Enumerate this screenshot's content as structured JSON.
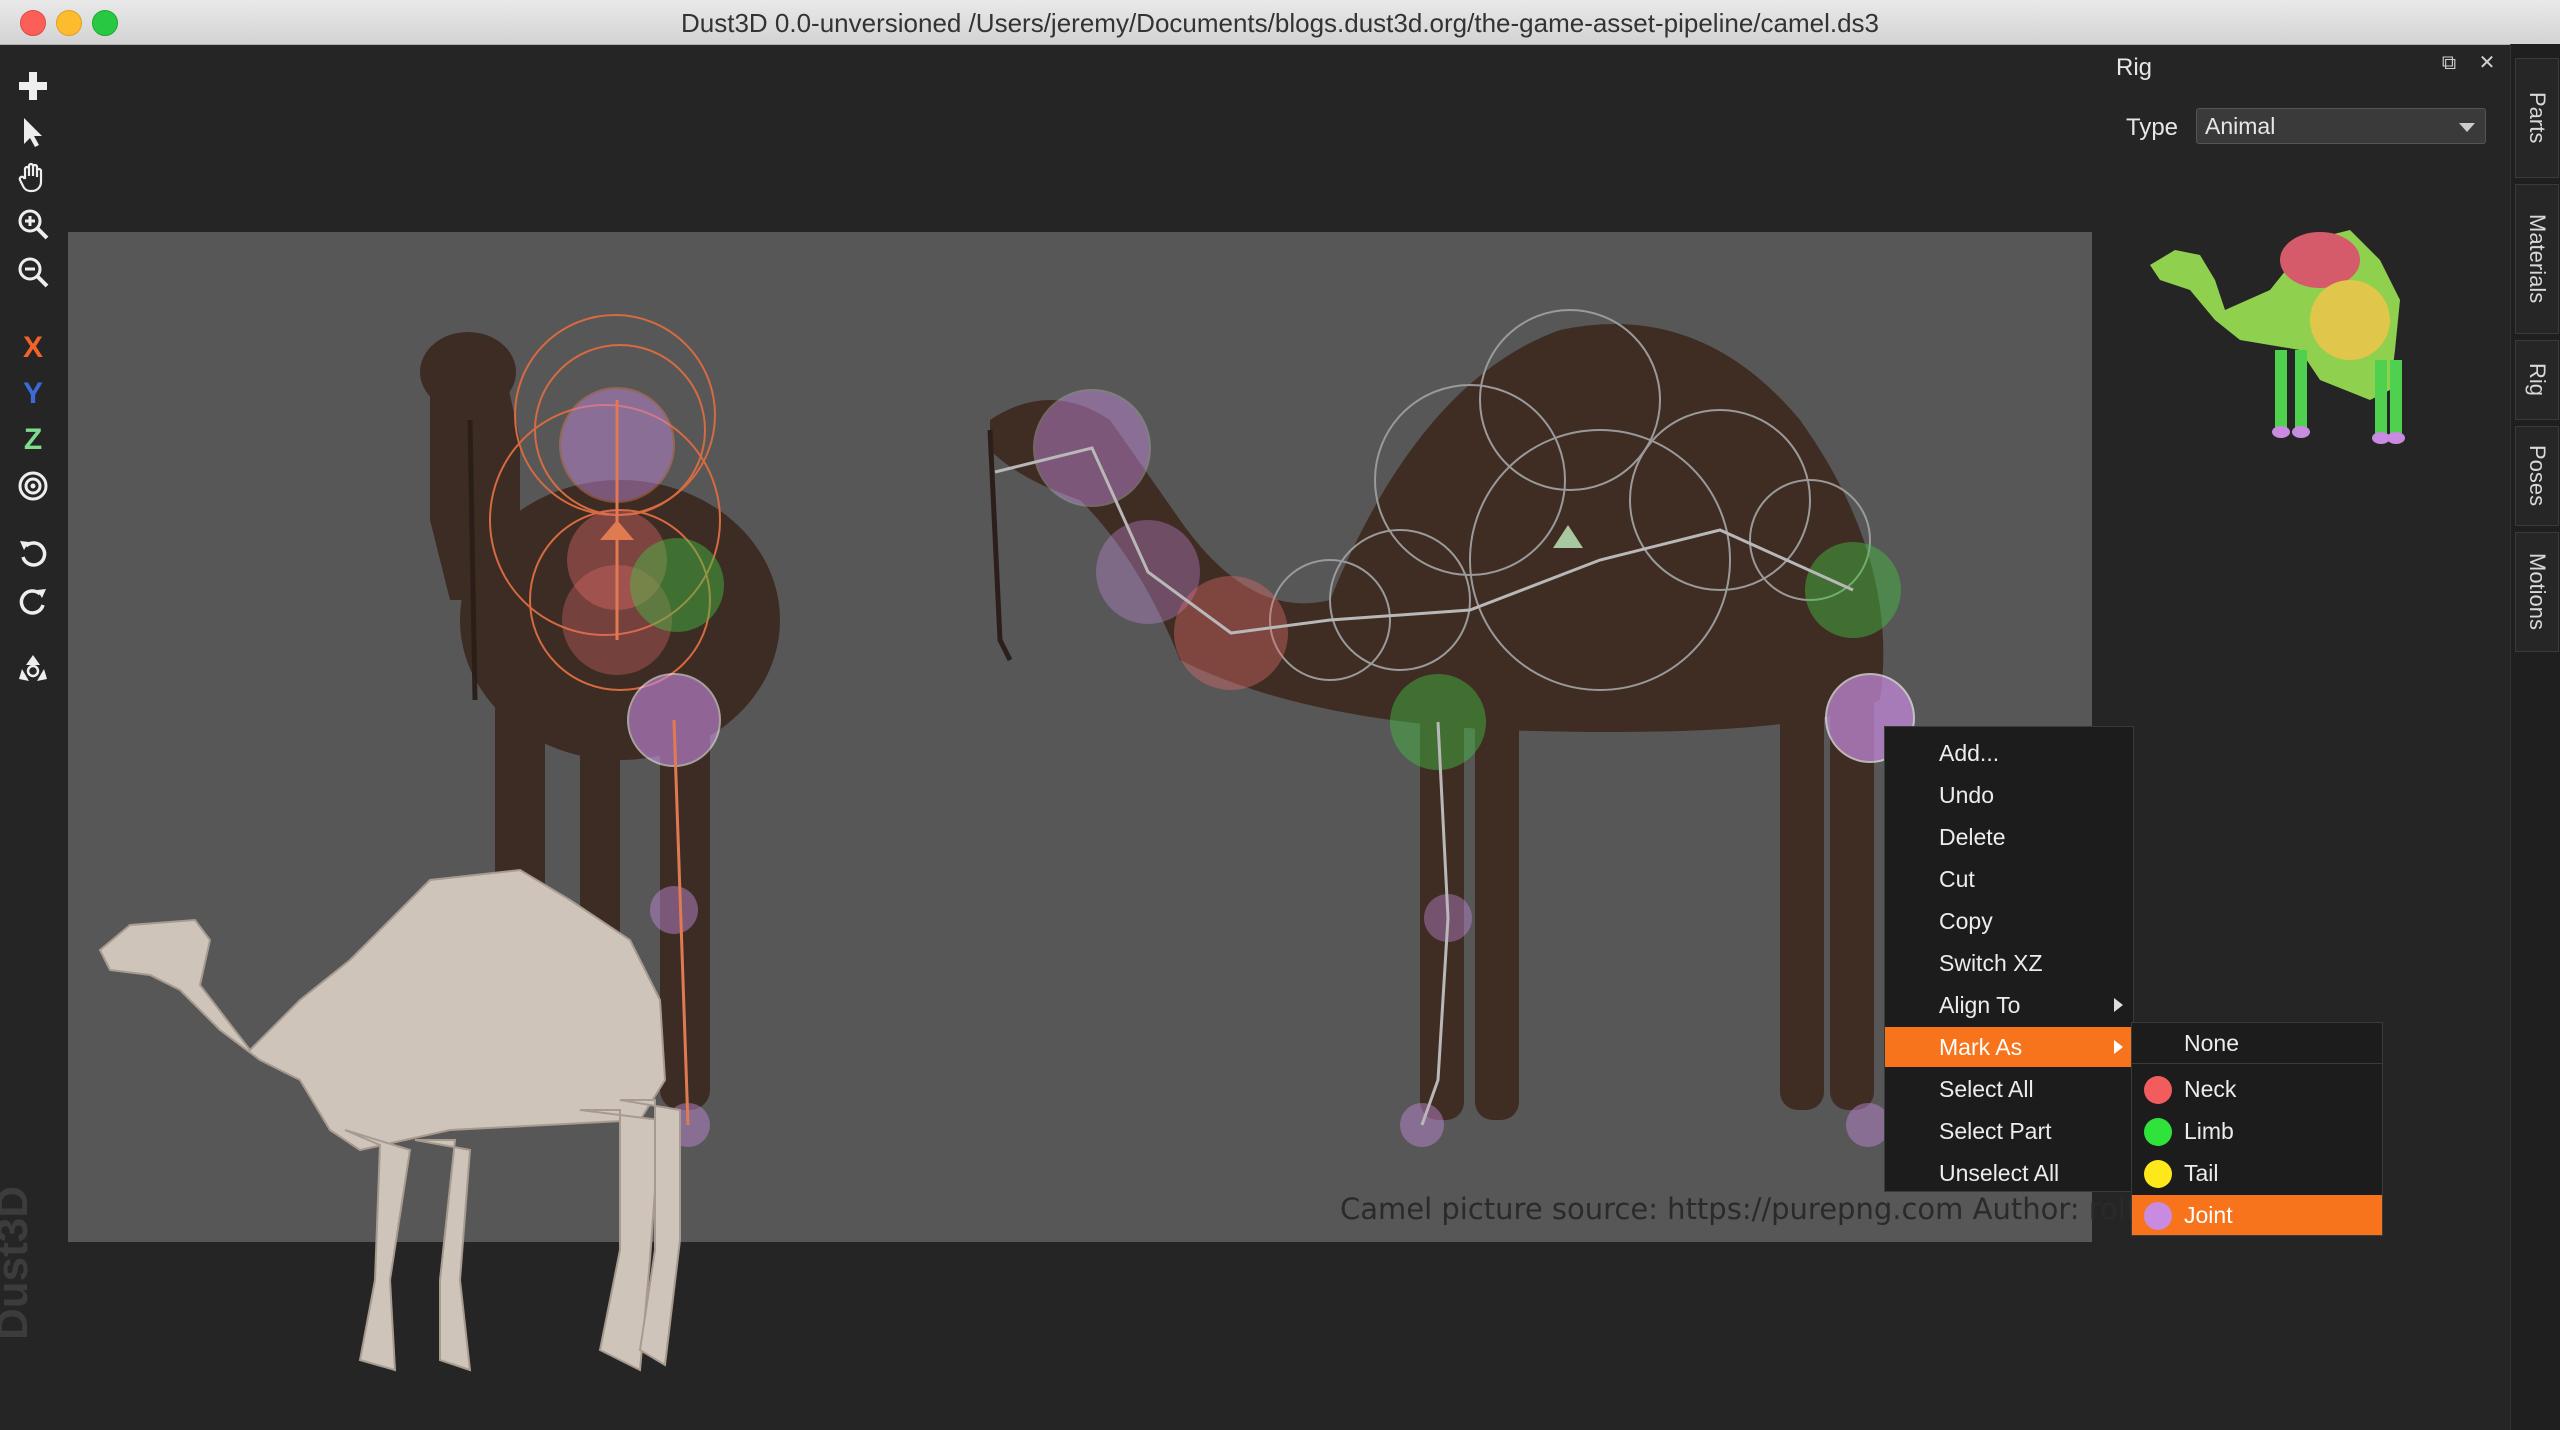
{
  "window": {
    "title": "Dust3D 0.0-unversioned /Users/jeremy/Documents/blogs.dust3d.org/the-game-asset-pipeline/camel.ds3"
  },
  "toolbar": {
    "x_label": "X",
    "y_label": "Y",
    "z_label": "Z"
  },
  "canvas": {
    "credit": "Camel picture source: https://purepng.com Author: rolf_nalder",
    "watermark": "Dust3D"
  },
  "rig_panel": {
    "title": "Rig",
    "type_label": "Type",
    "type_value": "Animal"
  },
  "tabs": [
    "Parts",
    "Materials",
    "Rig",
    "Poses",
    "Motions"
  ],
  "context_menu": {
    "items": [
      "Add...",
      "Undo",
      "Delete",
      "Cut",
      "Copy",
      "Switch XZ",
      "Align To",
      "Mark As",
      "Select All",
      "Select Part",
      "Unselect All"
    ],
    "active": "Mark As"
  },
  "mark_as_submenu": {
    "items": [
      {
        "label": "None",
        "color": ""
      },
      {
        "label": "Neck",
        "color": "#f25c5c"
      },
      {
        "label": "Limb",
        "color": "#2fe33a"
      },
      {
        "label": "Tail",
        "color": "#ffe81a"
      },
      {
        "label": "Joint",
        "color": "#c88be0"
      }
    ],
    "active": "Joint"
  },
  "colors": {
    "accent": "#f7741c",
    "neck": "#f25c5c",
    "limb": "#2fe33a",
    "tail": "#ffe81a",
    "joint": "#c88be0",
    "axis_x": "#f0632a",
    "axis_y": "#3a6bd6",
    "axis_z": "#7ddc8e"
  }
}
